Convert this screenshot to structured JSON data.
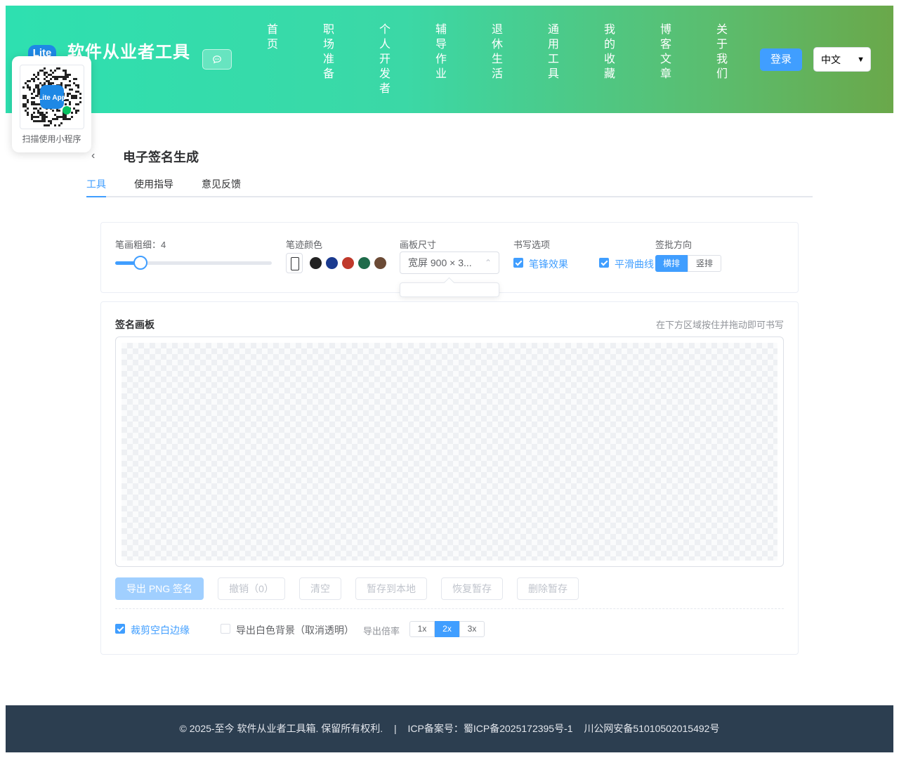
{
  "header": {
    "logo_text": "Lite",
    "site_title": "软件从业者工具",
    "nav": [
      "首页",
      "职场准备",
      "个人开发者",
      "辅导作业",
      "退休生活",
      "通用工具",
      "我的收藏",
      "博客文章",
      "关于我们"
    ],
    "login_label": "登录",
    "language": "中文",
    "colors": {
      "gradient_start": "#2ee0b0",
      "gradient_end": "#6aa84a"
    }
  },
  "qr_popup": {
    "badge_text": "Lite App",
    "caption": "扫描使用小程序"
  },
  "page": {
    "title": "电子签名生成",
    "tabs": [
      {
        "label": "工具",
        "active": true
      },
      {
        "label": "使用指导",
        "active": false
      },
      {
        "label": "意见反馈",
        "active": false
      }
    ]
  },
  "controls": {
    "stroke_label": "笔画粗细：4",
    "stroke_value": 4,
    "stroke_fraction": 0.16,
    "color_label": "笔迹颜色",
    "colors": [
      "#222222",
      "#1a3a8f",
      "#c0392b",
      "#1e6b4a",
      "#6b4a35"
    ],
    "size_label": "画板尺寸",
    "size_value": "宽屏 900 × 3...",
    "writing_label": "书写选项",
    "writing_options": [
      {
        "label": "笔锋效果",
        "checked": true
      },
      {
        "label": "平滑曲线",
        "checked": true
      }
    ],
    "direction_label": "签批方向",
    "direction_options": [
      {
        "label": "横排",
        "selected": true
      },
      {
        "label": "竖排",
        "selected": false
      }
    ]
  },
  "board": {
    "title": "签名画板",
    "hint": "在下方区域按住并拖动即可书写"
  },
  "actions": {
    "export_png": "导出 PNG 签名",
    "undo": "撤销（0）",
    "clear": "清空",
    "save_local": "暂存到本地",
    "restore": "恢复暂存",
    "delete_saved": "删除暂存"
  },
  "export_options": {
    "crop_label": "裁剪空白边缘",
    "crop_checked": true,
    "white_bg_label": "导出白色背景（取消透明）",
    "white_bg_checked": false,
    "scale_label": "导出倍率",
    "scales": [
      {
        "label": "1x",
        "selected": false
      },
      {
        "label": "2x",
        "selected": true
      },
      {
        "label": "3x",
        "selected": false
      }
    ]
  },
  "footer": {
    "copyright": "© 2025-至今 软件从业者工具箱. 保留所有权利.",
    "separator": "|",
    "icp": "ICP备案号：蜀ICP备2025172395号-1",
    "police": "川公网安备51010502015492号"
  }
}
